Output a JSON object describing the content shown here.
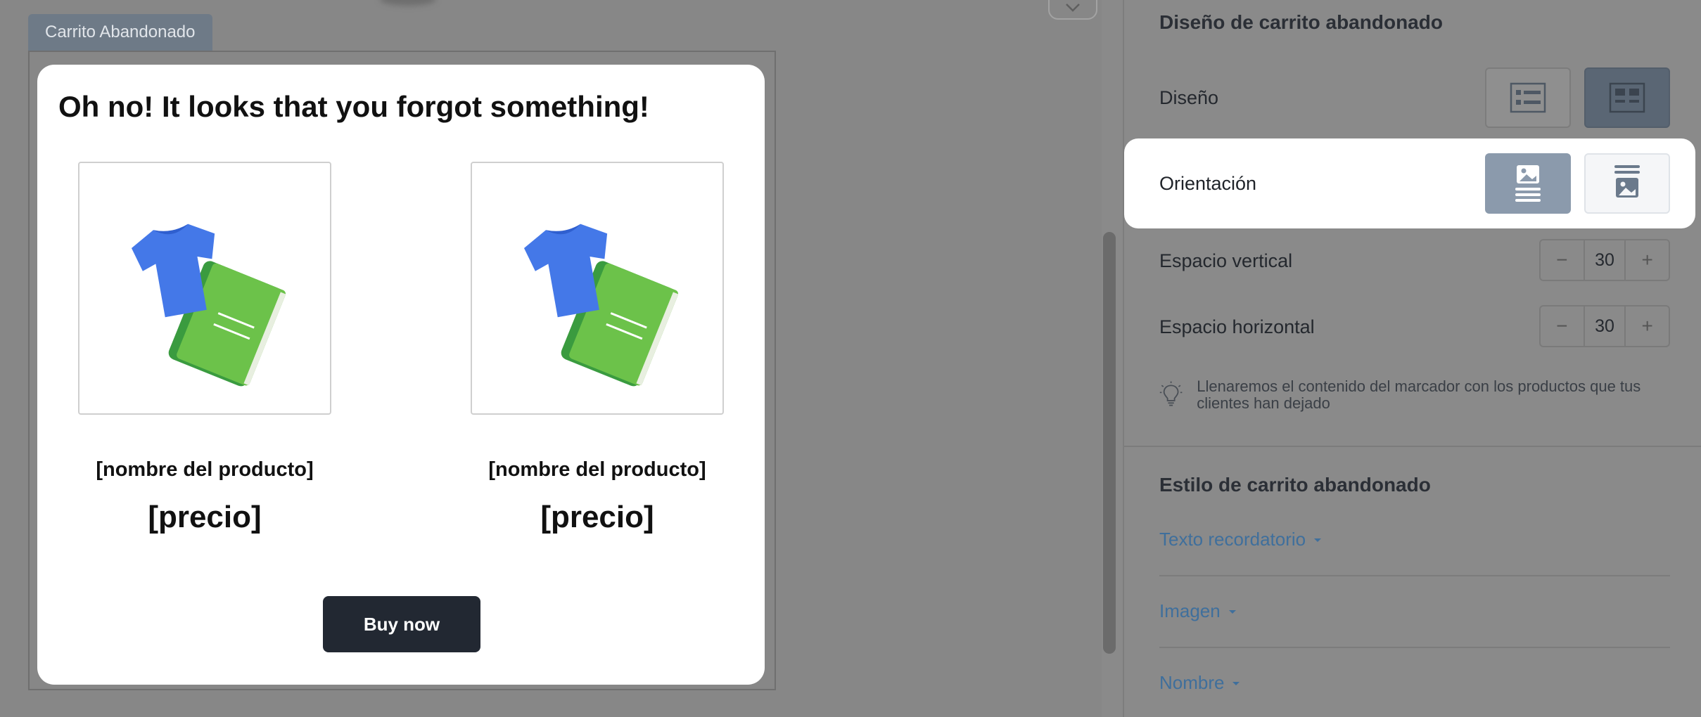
{
  "canvas": {
    "block_tag": "Carrito Abandonado"
  },
  "email": {
    "title": "Oh no! It looks that you forgot something!",
    "products": [
      {
        "name": "[nombre del producto]",
        "price": "[precio]"
      },
      {
        "name": "[nombre del producto]",
        "price": "[precio]"
      }
    ],
    "button_label": "Buy now"
  },
  "panel": {
    "design_section_title": "Diseño de carrito abandonado",
    "design_label": "Diseño",
    "orientation_label": "Orientación",
    "vertical_spacing": {
      "label": "Espacio vertical",
      "value": "30"
    },
    "horizontal_spacing": {
      "label": "Espacio horizontal",
      "value": "30"
    },
    "stepper_minus": "−",
    "stepper_plus": "+",
    "hint": "Llenaremos el contenido del marcador con los productos que tus clientes han dejado",
    "style_section_title": "Estilo de carrito abandonado",
    "accordions": [
      "Texto recordatorio",
      "Imagen",
      "Nombre"
    ]
  },
  "colors": {
    "accent_link": "#3f6f9c",
    "button_dark": "#222832",
    "selected_segment": "#5a6674"
  }
}
